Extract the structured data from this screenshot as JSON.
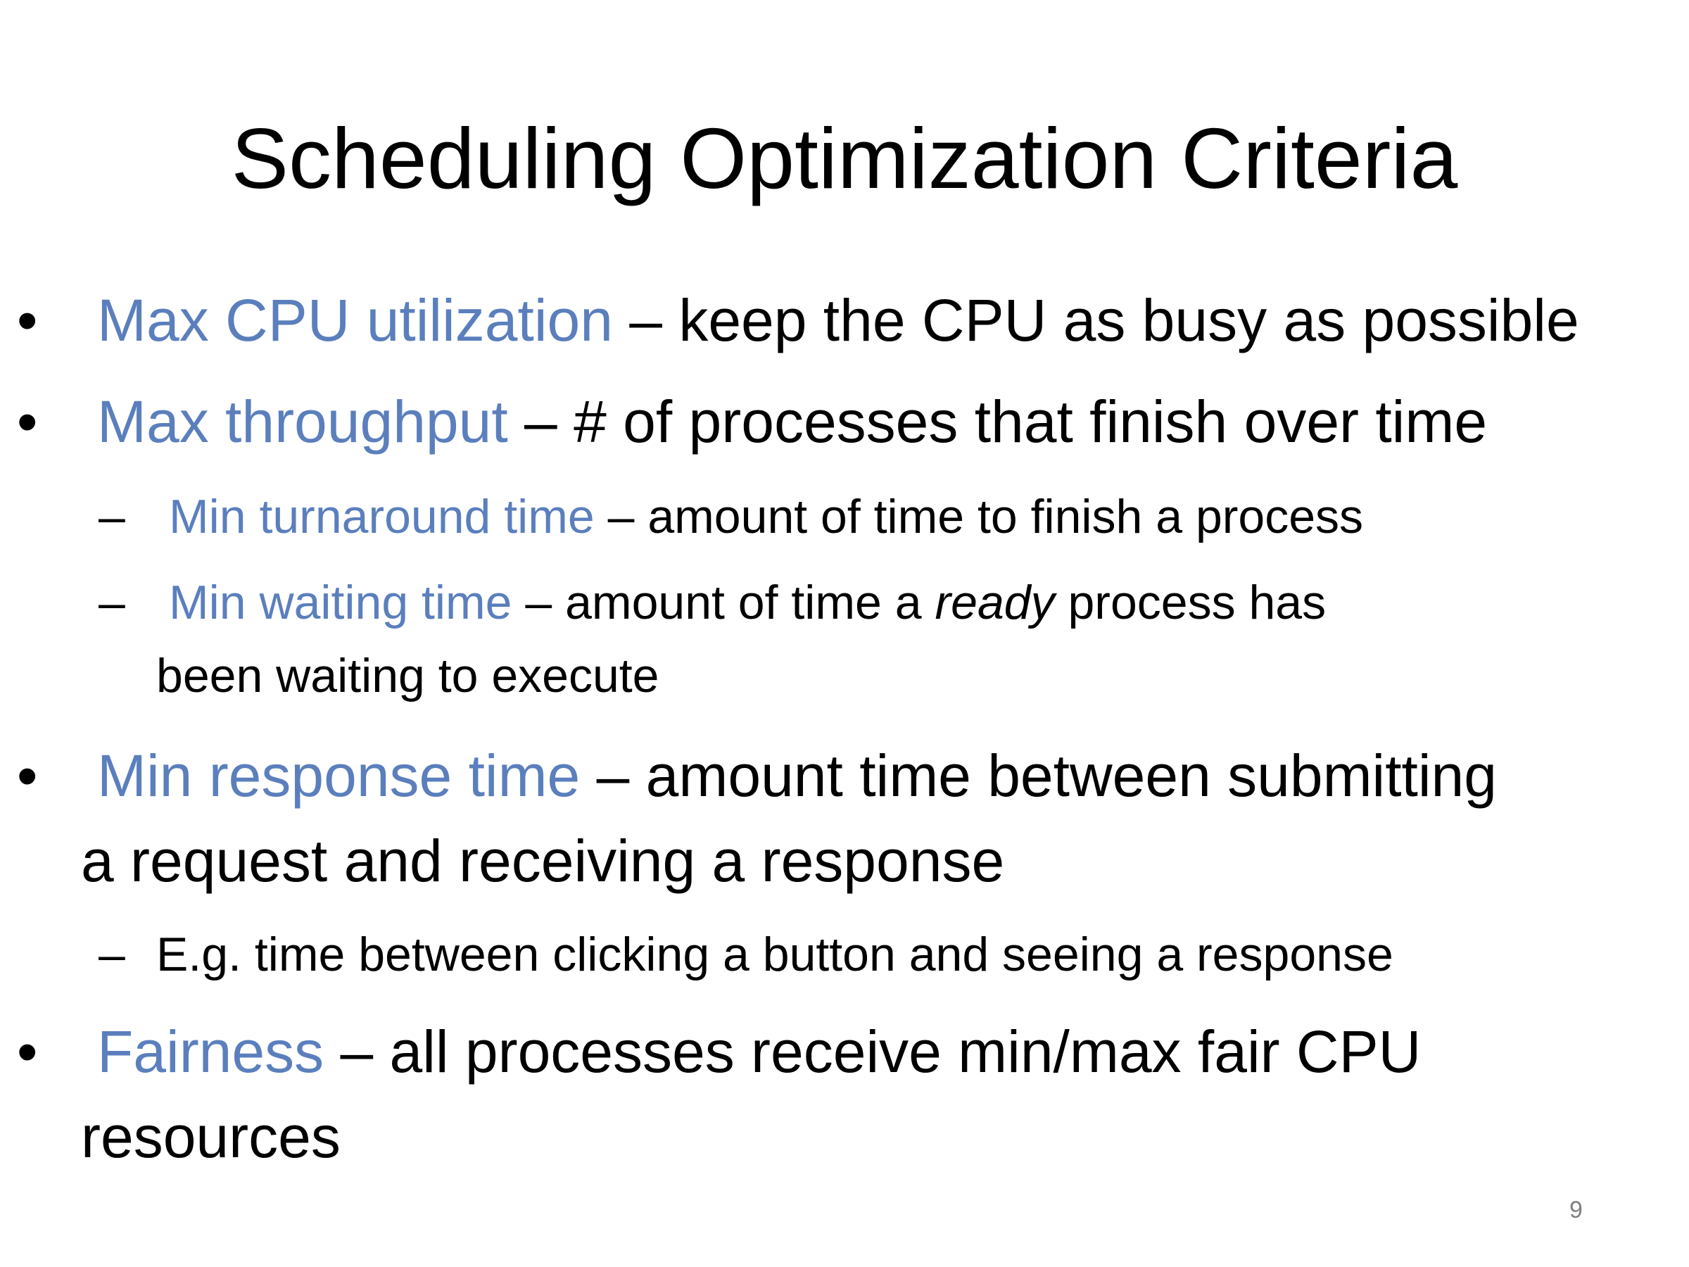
{
  "slide": {
    "title": "Scheduling Optimization Criteria",
    "bullet_symbol": "•",
    "dash_symbol": "–",
    "page_number": "9",
    "colors": {
      "term": "#5b7fbd",
      "text": "#000000",
      "page_number": "#7f7f7f"
    },
    "items": [
      {
        "term": "Max CPU utilization",
        "text": " – keep the CPU as busy as possible"
      },
      {
        "term": "Max throughput",
        "text": " – # of processes that finish over time"
      },
      {
        "term": "Min turnaround time",
        "text": " – amount of time to finish a process"
      },
      {
        "term": "Min waiting time",
        "text_before": " – amount of time a ",
        "emphasis": "ready",
        "text_after": " process has",
        "continuation": "been waiting to execute"
      },
      {
        "term": "Min response time",
        "text": " – amount time between submitting",
        "continuation": "a request and receiving a response"
      },
      {
        "text": "E.g. time between clicking a button and seeing a response"
      },
      {
        "term": "Fairness",
        "text": " – all processes receive min/max fair CPU",
        "continuation": "resources"
      }
    ]
  }
}
